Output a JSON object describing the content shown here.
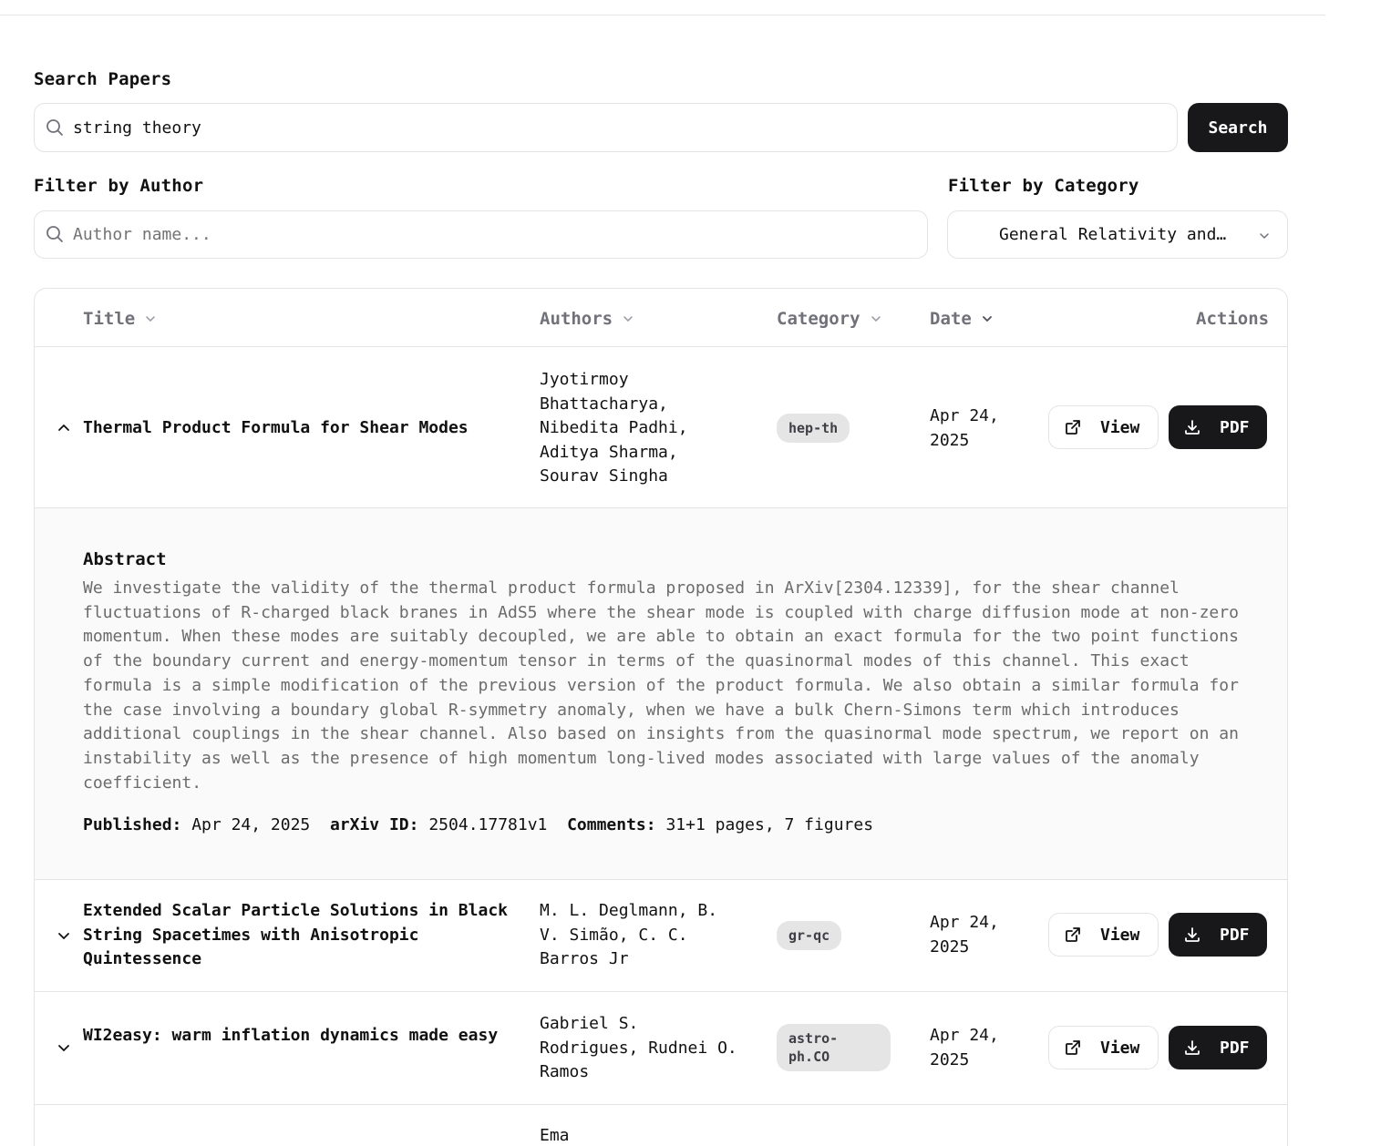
{
  "search": {
    "label": "Search Papers",
    "value": "string theory",
    "button": "Search"
  },
  "author_filter": {
    "label": "Filter by Author",
    "placeholder": "Author name..."
  },
  "category_filter": {
    "label": "Filter by Category",
    "selected": "General Relativity and…"
  },
  "table": {
    "headers": {
      "title": "Title",
      "authors": "Authors",
      "category": "Category",
      "date": "Date",
      "actions": "Actions"
    },
    "rows": [
      {
        "title": "Thermal Product Formula for Shear Modes",
        "authors": "Jyotirmoy Bhattacharya, Nibedita Padhi, Aditya Sharma, Sourav Singha",
        "category": "hep-th",
        "date": "Apr 24, 2025",
        "view": "View",
        "pdf": "PDF",
        "expanded": true
      },
      {
        "title": "Extended Scalar Particle Solutions in Black String Spacetimes with Anisotropic Quintessence",
        "authors": "M. L. Deglmann, B. V. Simão, C. C. Barros Jr",
        "category": "gr-qc",
        "date": "Apr 24, 2025",
        "view": "View",
        "pdf": "PDF",
        "expanded": false
      },
      {
        "title": "WI2easy: warm inflation dynamics made easy",
        "authors": "Gabriel S. Rodrigues, Rudnei O. Ramos",
        "category": "astro-ph.CO",
        "date": "Apr 24, 2025",
        "view": "View",
        "pdf": "PDF",
        "expanded": false
      },
      {
        "authors": "Ema"
      }
    ],
    "abstract": {
      "heading": "Abstract",
      "text": "We investigate the validity of the thermal product formula proposed in ArXiv[2304.12339], for the shear channel fluctuations of R-charged black branes in AdS5 where the shear mode is coupled with charge diffusion mode at non-zero momentum. When these modes are suitably decoupled, we are able to obtain an exact formula for the two point functions of the boundary current and energy-momentum tensor in terms of the quasinormal modes of this channel. This exact formula is a simple modification of the previous version of the product formula. We also obtain a similar formula for the case involving a boundary global R-symmetry anomaly, when we have a bulk Chern-Simons term which introduces additional couplings in the shear channel. Also based on insights from the quasinormal mode spectrum, we report on an instability as well as the presence of high momentum long-lived modes associated with large values of the anomaly coefficient.",
      "published_label": "Published:",
      "published": "Apr 24, 2025",
      "arxiv_label": "arXiv ID:",
      "arxiv_id": "2504.17781v1",
      "comments_label": "Comments:",
      "comments": "31+1 pages, 7 figures"
    }
  }
}
